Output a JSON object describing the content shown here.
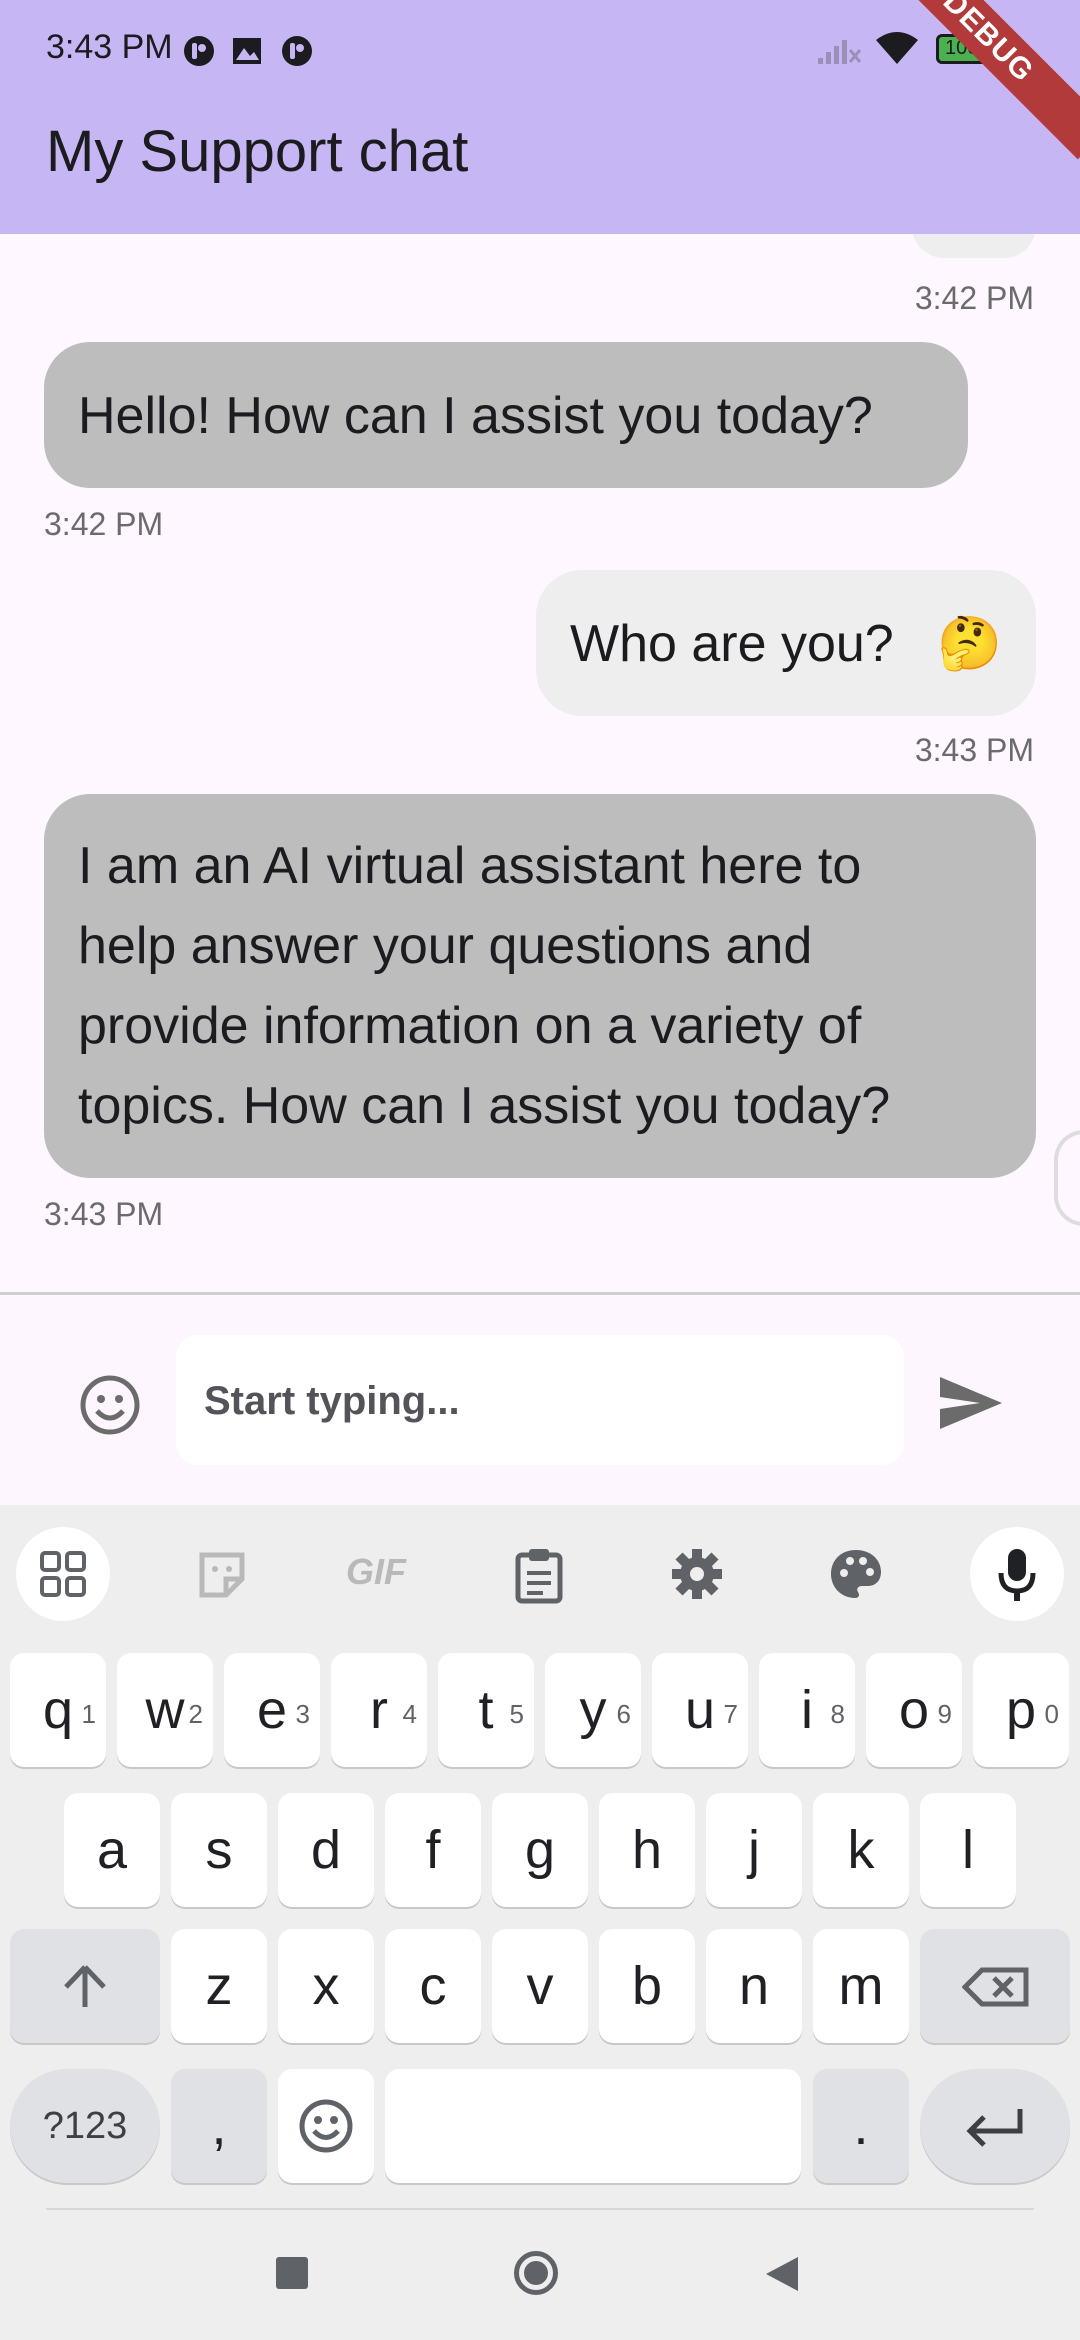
{
  "status_bar": {
    "time": "3:43 PM",
    "battery": "100",
    "debug_banner": "DEBUG"
  },
  "app_bar": {
    "title": "My Support chat"
  },
  "messages": [
    {
      "sender": "bot",
      "text": "Hello! How can I assist you today?",
      "time": "3:42 PM"
    },
    {
      "sender": "user",
      "text": "Who are you?",
      "emoji": "🤔",
      "time": "3:43 PM"
    },
    {
      "sender": "bot",
      "lines": [
        "I am an AI virtual assistant here to",
        "help answer your questions and",
        "provide information on a variety of",
        "topics. How can I assist you today?"
      ],
      "time": "3:43 PM"
    }
  ],
  "prev_message_time": "3:42 PM",
  "composer": {
    "placeholder": "Start typing..."
  },
  "keyboard": {
    "toolbar": [
      "apps-grid-icon",
      "sticker-icon",
      "GIF",
      "clipboard-icon",
      "settings-icon",
      "palette-icon",
      "mic-icon"
    ],
    "row1": [
      {
        "k": "q",
        "n": "1"
      },
      {
        "k": "w",
        "n": "2"
      },
      {
        "k": "e",
        "n": "3"
      },
      {
        "k": "r",
        "n": "4"
      },
      {
        "k": "t",
        "n": "5"
      },
      {
        "k": "y",
        "n": "6"
      },
      {
        "k": "u",
        "n": "7"
      },
      {
        "k": "i",
        "n": "8"
      },
      {
        "k": "o",
        "n": "9"
      },
      {
        "k": "p",
        "n": "0"
      }
    ],
    "row2": [
      "a",
      "s",
      "d",
      "f",
      "g",
      "h",
      "j",
      "k",
      "l"
    ],
    "row3": [
      "z",
      "x",
      "c",
      "v",
      "b",
      "n",
      "m"
    ],
    "symbols_key": "?123",
    "comma_key": ",",
    "period_key": "."
  },
  "colors": {
    "app_bar": "#c7b6f4",
    "bot_bubble": "#bdbdbd",
    "user_bubble": "#eeeeee",
    "background": "#fef7ff"
  }
}
